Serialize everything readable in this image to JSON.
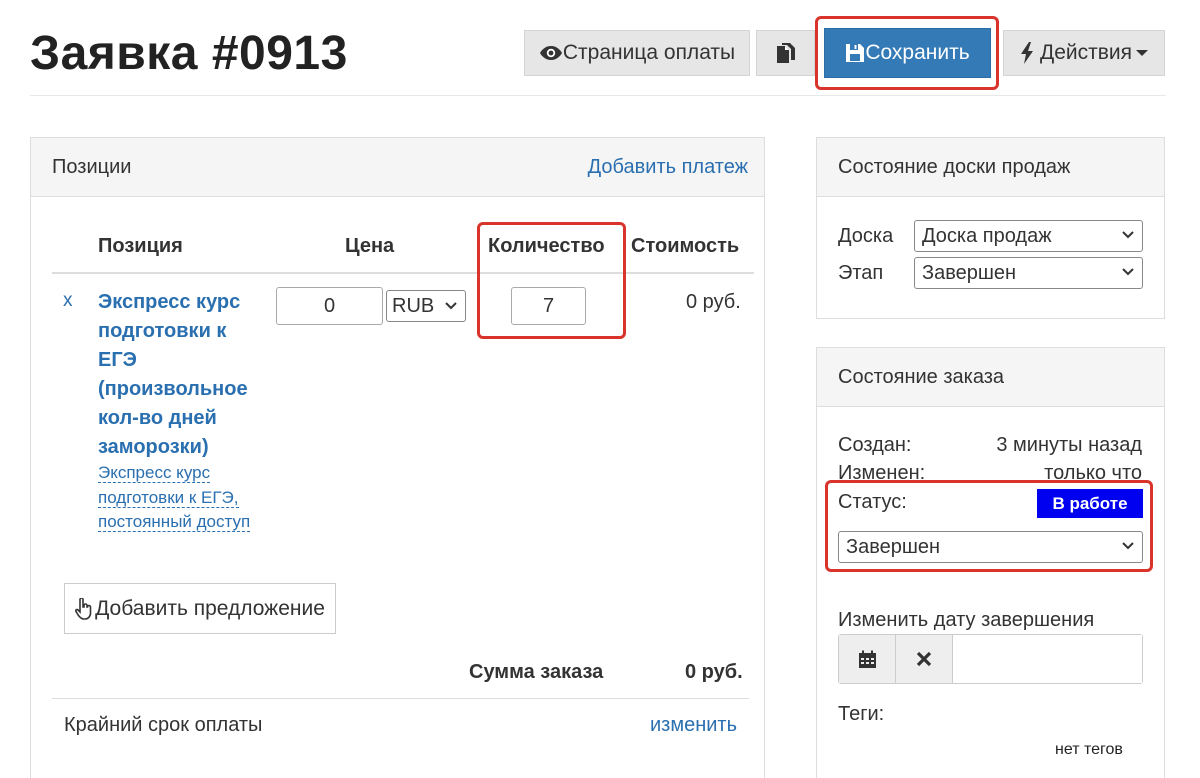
{
  "page": {
    "title": "Заявка #0913"
  },
  "toolbar": {
    "payment_page_label": "Страница оплаты",
    "save_label": "Сохранить",
    "actions_label": "Действия"
  },
  "positions_panel": {
    "title": "Позиции",
    "add_payment_link": "Добавить платеж",
    "columns": [
      "Позиция",
      "Цена",
      "Количество",
      "Стоимость"
    ],
    "items": [
      {
        "remove_label": "x",
        "name": "Экспресс курс подготовки к ЕГЭ (произвольное кол-во дней заморозки)",
        "offer_name": "Экспресс курс подготовки к ЕГЭ, постоянный доступ",
        "price": "0",
        "currency": "RUB",
        "quantity": "7",
        "cost": "0 руб."
      }
    ],
    "add_offer_label": "Добавить предложение",
    "total_label": "Сумма заказа",
    "total_value": "0 руб.",
    "deadline_label": "Крайний срок оплаты",
    "deadline_change_link": "изменить"
  },
  "board_panel": {
    "title": "Состояние доски продаж",
    "board_label": "Доска",
    "board_value": "Доска продаж",
    "stage_label": "Этап",
    "stage_value": "Завершен"
  },
  "order_panel": {
    "title": "Состояние заказа",
    "created_label": "Создан:",
    "created_value": "3 минуты назад",
    "modified_label": "Изменен:",
    "modified_value": "только что",
    "status_label": "Статус:",
    "status_badge": "В работе",
    "status_select_value": "Завершен",
    "change_date_label": "Изменить дату завершения",
    "tags_label": "Теги:",
    "no_tags": "нет тегов"
  },
  "colors": {
    "primary": "#337ab7",
    "link": "#2a6fb0",
    "highlight": "#d9342b",
    "status_badge": "#0000f0"
  }
}
